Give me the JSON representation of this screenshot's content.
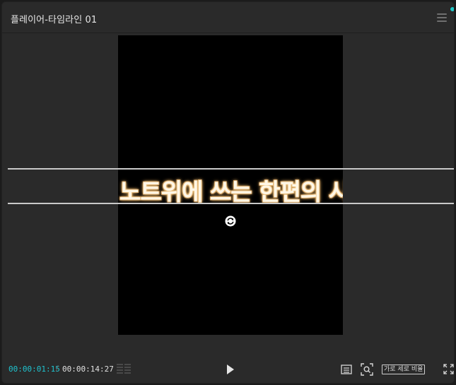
{
  "panel": {
    "title": "플레이어-타임라인 01",
    "accent_color": "#1ec8c8"
  },
  "icons": {
    "menu": "hamburger-menu-icon",
    "rotate": "rotate-icon",
    "list": "waveform-list-icon",
    "play": "play-icon",
    "safe_area": "safe-area-icon",
    "zoom": "zoom-fit-icon",
    "fullscreen": "fullscreen-icon"
  },
  "preview": {
    "caption": "노트위에 쓰는 한편의 시"
  },
  "controls": {
    "current_time": "00:00:01:15",
    "separator": "/",
    "total_time": "00:00:14:27",
    "ratio_label": "가로 세로 비율"
  }
}
